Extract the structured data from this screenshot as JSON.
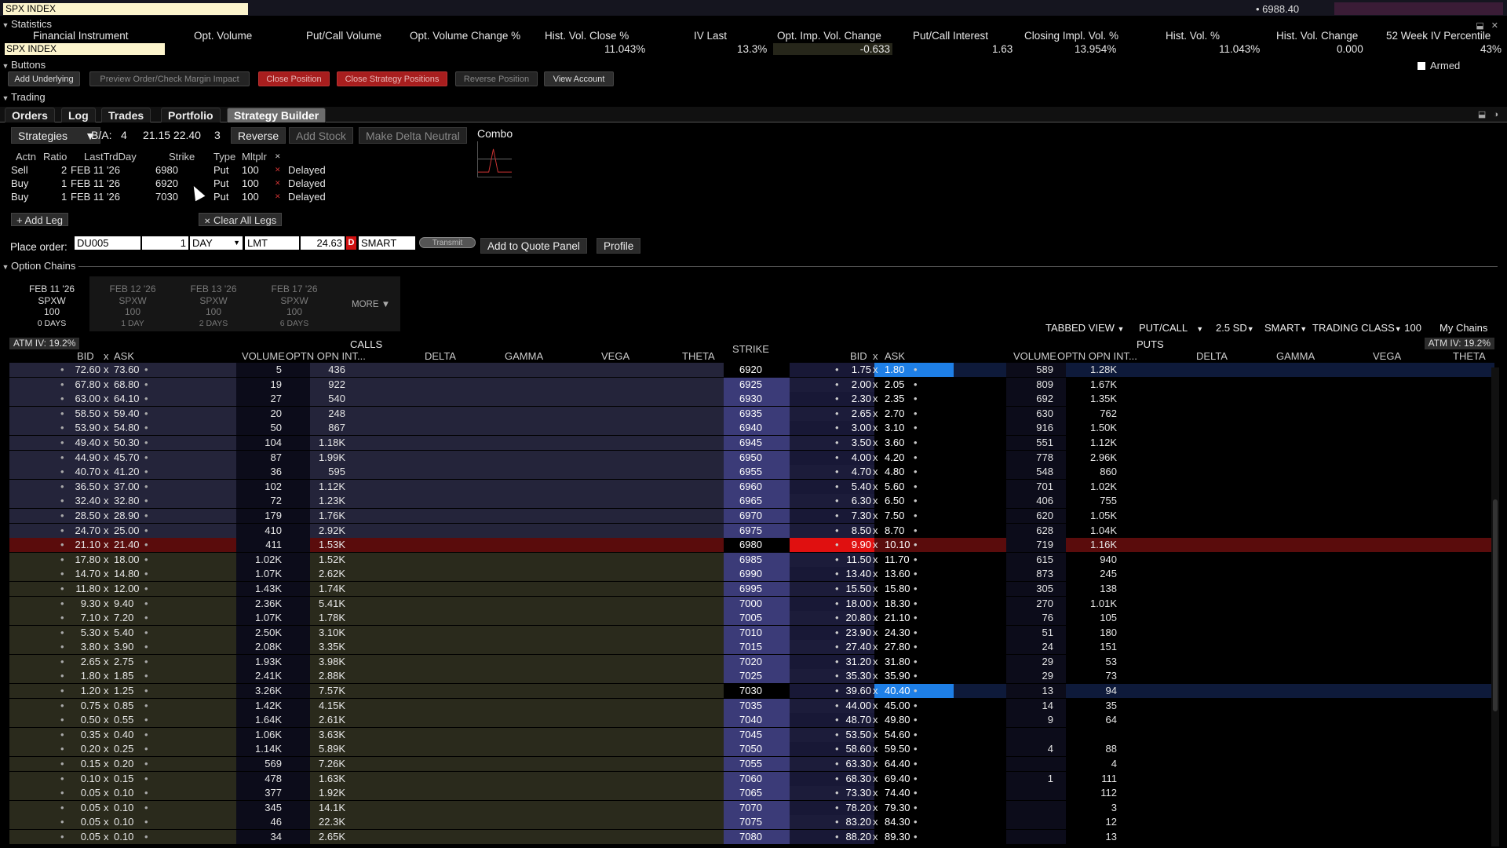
{
  "topbar": {
    "symbol": "SPX INDEX",
    "last": "• 6988.40"
  },
  "sections": {
    "statistics": "Statistics",
    "buttons": "Buttons",
    "trading": "Trading",
    "option_chains": "Option Chains"
  },
  "statistics": {
    "headers": [
      "Financial Instrument",
      "Opt. Volume",
      "Put/Call Volume",
      "Opt. Volume Change %",
      "Hist. Vol. Close %",
      "IV Last",
      "Opt. Imp. Vol. Change",
      "Put/Call Interest",
      "Closing Impl. Vol. %",
      "Hist. Vol. %",
      "Hist. Vol. Change",
      "52 Week IV Percentile"
    ],
    "symbol": "SPX INDEX",
    "values": [
      "11.043%",
      "13.3%",
      "-0.633",
      "1.63",
      "13.954%",
      "11.043%",
      "0.000",
      "43%"
    ]
  },
  "buttons": {
    "add_underlying": "Add Underlying",
    "preview": "Preview Order/Check Margin Impact",
    "close_position": "Close Position",
    "close_strategy": "Close Strategy Positions",
    "reverse_position": "Reverse Position",
    "view_account": "View Account",
    "armed": "Armed"
  },
  "tabs": [
    "Orders",
    "Log",
    "Trades",
    "Portfolio",
    "Strategy Builder"
  ],
  "strategy": {
    "strategies_label": "Strategies",
    "ba_label": "B/A:",
    "ba_size_bid": "4",
    "ba_prices": "21.15 22.40",
    "ba_size_ask": "3",
    "reverse": "Reverse",
    "add_stock": "Add Stock",
    "make_delta_neutral": "Make Delta Neutral",
    "combo": "Combo",
    "leg_headers": {
      "actn": "Actn",
      "ratio": "Ratio",
      "last_trd_day": "LastTrdDay",
      "strike": "Strike",
      "type": "Type",
      "mltplr": "Mltplr"
    },
    "legs": [
      {
        "actn": "Sell",
        "ratio": "2",
        "day": "FEB 11 '26",
        "strike": "6980",
        "type": "Put",
        "mult": "100",
        "status": "Delayed"
      },
      {
        "actn": "Buy",
        "ratio": "1",
        "day": "FEB 11 '26",
        "strike": "6920",
        "type": "Put",
        "mult": "100",
        "status": "Delayed"
      },
      {
        "actn": "Buy",
        "ratio": "1",
        "day": "FEB 11 '26",
        "strike": "7030",
        "type": "Put",
        "mult": "100",
        "status": "Delayed"
      }
    ],
    "add_leg": "+ Add Leg",
    "clear_all_legs": "Clear All Legs"
  },
  "order": {
    "label": "Place order:",
    "account": "DU005",
    "quantity": "1",
    "tif": "DAY",
    "type": "LMT",
    "price": "24.63",
    "d_badge": "D",
    "route": "SMART",
    "transmit": "Transmit",
    "add_to_quote": "Add to Quote Panel",
    "profile": "Profile"
  },
  "expiries": [
    {
      "date": "FEB 11 '26",
      "cls": "SPXW",
      "mult": "100",
      "days": "0 DAYS"
    },
    {
      "date": "FEB 12 '26",
      "cls": "SPXW",
      "mult": "100",
      "days": "1 DAY"
    },
    {
      "date": "FEB 13 '26",
      "cls": "SPXW",
      "mult": "100",
      "days": "2 DAYS"
    },
    {
      "date": "FEB 17 '26",
      "cls": "SPXW",
      "mult": "100",
      "days": "6 DAYS"
    }
  ],
  "more": "MORE",
  "chain_controls": {
    "view": "TABBED VIEW",
    "putcall": "PUT/CALL",
    "sd": "2.5 SD",
    "route": "SMART",
    "trading_class": "TRADING CLASS",
    "tc_value": "100",
    "my_chains": "My Chains"
  },
  "chain": {
    "atm_iv_calls": "ATM IV: 19.2%",
    "atm_iv_puts": "ATM IV: 19.2%",
    "calls_label": "CALLS",
    "puts_label": "PUTS",
    "strike_label": "STRIKE",
    "call_cols": [
      "BID",
      "x",
      "ASK",
      "VOLUME",
      "OPTN OPN INT...",
      "DELTA",
      "GAMMA",
      "VEGA",
      "THETA"
    ],
    "put_cols": [
      "BID",
      "x",
      "ASK",
      "VOLUME",
      "OPTN OPN INT...",
      "DELTA",
      "GAMMA",
      "VEGA",
      "THETA"
    ],
    "rows": [
      {
        "cb": "72.60",
        "ca": "73.60",
        "cv": "5",
        "co": "436",
        "k": "6920",
        "pb": "1.75",
        "pa": "1.80",
        "pv": "589",
        "po": "1.28K"
      },
      {
        "cb": "67.80",
        "ca": "68.80",
        "cv": "19",
        "co": "922",
        "k": "6925",
        "pb": "2.00",
        "pa": "2.05",
        "pv": "809",
        "po": "1.67K"
      },
      {
        "cb": "63.00",
        "ca": "64.10",
        "cv": "27",
        "co": "540",
        "k": "6930",
        "pb": "2.30",
        "pa": "2.35",
        "pv": "692",
        "po": "1.35K"
      },
      {
        "cb": "58.50",
        "ca": "59.40",
        "cv": "20",
        "co": "248",
        "k": "6935",
        "pb": "2.65",
        "pa": "2.70",
        "pv": "630",
        "po": "762"
      },
      {
        "cb": "53.90",
        "ca": "54.80",
        "cv": "50",
        "co": "867",
        "k": "6940",
        "pb": "3.00",
        "pa": "3.10",
        "pv": "916",
        "po": "1.50K"
      },
      {
        "cb": "49.40",
        "ca": "50.30",
        "cv": "104",
        "co": "1.18K",
        "k": "6945",
        "pb": "3.50",
        "pa": "3.60",
        "pv": "551",
        "po": "1.12K"
      },
      {
        "cb": "44.90",
        "ca": "45.70",
        "cv": "87",
        "co": "1.99K",
        "k": "6950",
        "pb": "4.00",
        "pa": "4.20",
        "pv": "778",
        "po": "2.96K"
      },
      {
        "cb": "40.70",
        "ca": "41.20",
        "cv": "36",
        "co": "595",
        "k": "6955",
        "pb": "4.70",
        "pa": "4.80",
        "pv": "548",
        "po": "860"
      },
      {
        "cb": "36.50",
        "ca": "37.00",
        "cv": "102",
        "co": "1.12K",
        "k": "6960",
        "pb": "5.40",
        "pa": "5.60",
        "pv": "701",
        "po": "1.02K"
      },
      {
        "cb": "32.40",
        "ca": "32.80",
        "cv": "72",
        "co": "1.23K",
        "k": "6965",
        "pb": "6.30",
        "pa": "6.50",
        "pv": "406",
        "po": "755"
      },
      {
        "cb": "28.50",
        "ca": "28.90",
        "cv": "179",
        "co": "1.76K",
        "k": "6970",
        "pb": "7.30",
        "pa": "7.50",
        "pv": "620",
        "po": "1.05K"
      },
      {
        "cb": "24.70",
        "ca": "25.00",
        "cv": "410",
        "co": "2.92K",
        "k": "6975",
        "pb": "8.50",
        "pa": "8.70",
        "pv": "628",
        "po": "1.04K"
      },
      {
        "cb": "21.10",
        "ca": "21.40",
        "cv": "411",
        "co": "1.53K",
        "k": "6980",
        "pb": "9.90",
        "pa": "10.10",
        "pv": "719",
        "po": "1.16K"
      },
      {
        "cb": "17.80",
        "ca": "18.00",
        "cv": "1.02K",
        "co": "1.52K",
        "k": "6985",
        "pb": "11.50",
        "pa": "11.70",
        "pv": "615",
        "po": "940"
      },
      {
        "cb": "14.70",
        "ca": "14.80",
        "cv": "1.07K",
        "co": "2.62K",
        "k": "6990",
        "pb": "13.40",
        "pa": "13.60",
        "pv": "873",
        "po": "245"
      },
      {
        "cb": "11.80",
        "ca": "12.00",
        "cv": "1.43K",
        "co": "1.74K",
        "k": "6995",
        "pb": "15.50",
        "pa": "15.80",
        "pv": "305",
        "po": "138"
      },
      {
        "cb": "9.30",
        "ca": "9.40",
        "cv": "2.36K",
        "co": "5.41K",
        "k": "7000",
        "pb": "18.00",
        "pa": "18.30",
        "pv": "270",
        "po": "1.01K"
      },
      {
        "cb": "7.10",
        "ca": "7.20",
        "cv": "1.07K",
        "co": "1.78K",
        "k": "7005",
        "pb": "20.80",
        "pa": "21.10",
        "pv": "76",
        "po": "105"
      },
      {
        "cb": "5.30",
        "ca": "5.40",
        "cv": "2.50K",
        "co": "3.10K",
        "k": "7010",
        "pb": "23.90",
        "pa": "24.30",
        "pv": "51",
        "po": "180"
      },
      {
        "cb": "3.80",
        "ca": "3.90",
        "cv": "2.08K",
        "co": "3.35K",
        "k": "7015",
        "pb": "27.40",
        "pa": "27.80",
        "pv": "24",
        "po": "151"
      },
      {
        "cb": "2.65",
        "ca": "2.75",
        "cv": "1.93K",
        "co": "3.98K",
        "k": "7020",
        "pb": "31.20",
        "pa": "31.80",
        "pv": "29",
        "po": "53"
      },
      {
        "cb": "1.80",
        "ca": "1.85",
        "cv": "2.41K",
        "co": "2.88K",
        "k": "7025",
        "pb": "35.30",
        "pa": "35.90",
        "pv": "29",
        "po": "73"
      },
      {
        "cb": "1.20",
        "ca": "1.25",
        "cv": "3.26K",
        "co": "7.57K",
        "k": "7030",
        "pb": "39.60",
        "pa": "40.40",
        "pv": "13",
        "po": "94"
      },
      {
        "cb": "0.75",
        "ca": "0.85",
        "cv": "1.42K",
        "co": "4.15K",
        "k": "7035",
        "pb": "44.00",
        "pa": "45.00",
        "pv": "14",
        "po": "35"
      },
      {
        "cb": "0.50",
        "ca": "0.55",
        "cv": "1.64K",
        "co": "2.61K",
        "k": "7040",
        "pb": "48.70",
        "pa": "49.80",
        "pv": "9",
        "po": "64"
      },
      {
        "cb": "0.35",
        "ca": "0.40",
        "cv": "1.06K",
        "co": "3.63K",
        "k": "7045",
        "pb": "53.50",
        "pa": "54.60",
        "pv": "",
        "po": ""
      },
      {
        "cb": "0.20",
        "ca": "0.25",
        "cv": "1.14K",
        "co": "5.89K",
        "k": "7050",
        "pb": "58.60",
        "pa": "59.50",
        "pv": "4",
        "po": "88"
      },
      {
        "cb": "0.15",
        "ca": "0.20",
        "cv": "569",
        "co": "7.26K",
        "k": "7055",
        "pb": "63.30",
        "pa": "64.40",
        "pv": "",
        "po": "4"
      },
      {
        "cb": "0.10",
        "ca": "0.15",
        "cv": "478",
        "co": "1.63K",
        "k": "7060",
        "pb": "68.30",
        "pa": "69.40",
        "pv": "1",
        "po": "111"
      },
      {
        "cb": "0.05",
        "ca": "0.10",
        "cv": "377",
        "co": "1.92K",
        "k": "7065",
        "pb": "73.30",
        "pa": "74.40",
        "pv": "",
        "po": "112"
      },
      {
        "cb": "0.05",
        "ca": "0.10",
        "cv": "345",
        "co": "14.1K",
        "k": "7070",
        "pb": "78.20",
        "pa": "79.30",
        "pv": "",
        "po": "3"
      },
      {
        "cb": "0.05",
        "ca": "0.10",
        "cv": "46",
        "co": "22.3K",
        "k": "7075",
        "pb": "83.20",
        "pa": "84.30",
        "pv": "",
        "po": "12"
      },
      {
        "cb": "0.05",
        "ca": "0.10",
        "cv": "34",
        "co": "2.65K",
        "k": "7080",
        "pb": "88.20",
        "pa": "89.30",
        "pv": "",
        "po": "13"
      }
    ],
    "sell_strike": "6980",
    "buy_strikes": [
      "6920",
      "7030"
    ]
  },
  "colors": {
    "sell_row": "#e01010",
    "buy_ask": "#1e7fe6",
    "strike_col": "#3b3b78",
    "call_itm": "#24243a",
    "call_otm": "#2a2a1c"
  }
}
